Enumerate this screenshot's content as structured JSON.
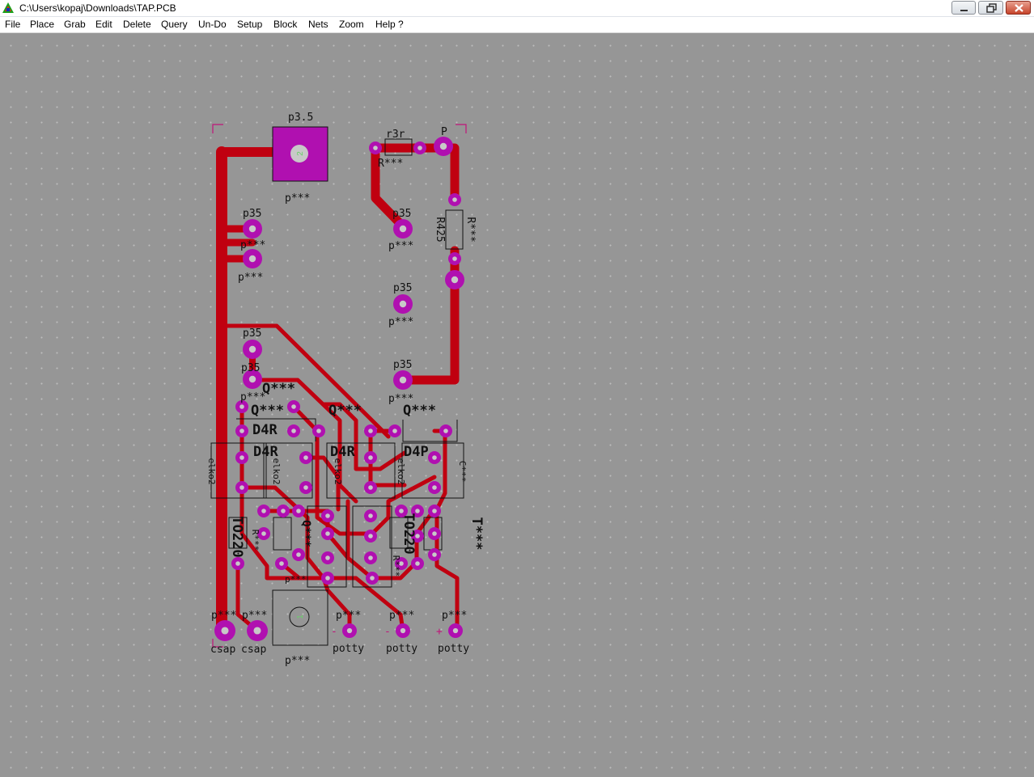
{
  "window": {
    "title": "C:\\Users\\kopaj\\Downloads\\TAP.PCB",
    "app_icon": "pcb-app-icon",
    "controls": [
      "minimize",
      "maximize",
      "close"
    ]
  },
  "menu": [
    {
      "id": "file",
      "label": "File"
    },
    {
      "id": "place",
      "label": "Place"
    },
    {
      "id": "grab",
      "label": "Grab"
    },
    {
      "id": "edit",
      "label": "Edit"
    },
    {
      "id": "delete",
      "label": "Delete"
    },
    {
      "id": "query",
      "label": "Query"
    },
    {
      "id": "undo",
      "label": "Un-Do"
    },
    {
      "id": "setup",
      "label": "Setup"
    },
    {
      "id": "block",
      "label": "Block"
    },
    {
      "id": "nets",
      "label": "Nets"
    },
    {
      "id": "zoom",
      "label": "Zoom"
    },
    {
      "id": "help",
      "label": "Help ?"
    }
  ],
  "colors": {
    "background": "#969696",
    "grid_dot": "#bdbdbd",
    "trace": "#c00010",
    "pad": "#b010b0",
    "pad_hole": "#c8c8c8",
    "silkscreen": "#111111"
  },
  "board": {
    "labels": {
      "p35_top": "p3.5",
      "p_ref": "p***",
      "p35": "p35",
      "r3r": "r3r",
      "r_ref": "R***",
      "p_label": "P",
      "r425": "R425",
      "q_ref": "Q***",
      "d4r": "D4R",
      "d4p": "D4P",
      "elko2": "elko2",
      "c_ref": "C***",
      "to220": "TO220",
      "t_ref": "T***",
      "csap": "csap",
      "potty": "potty",
      "pad_2": "2",
      "pad_1": "1",
      "sign_minus": "-",
      "sign_plus": "+"
    }
  }
}
